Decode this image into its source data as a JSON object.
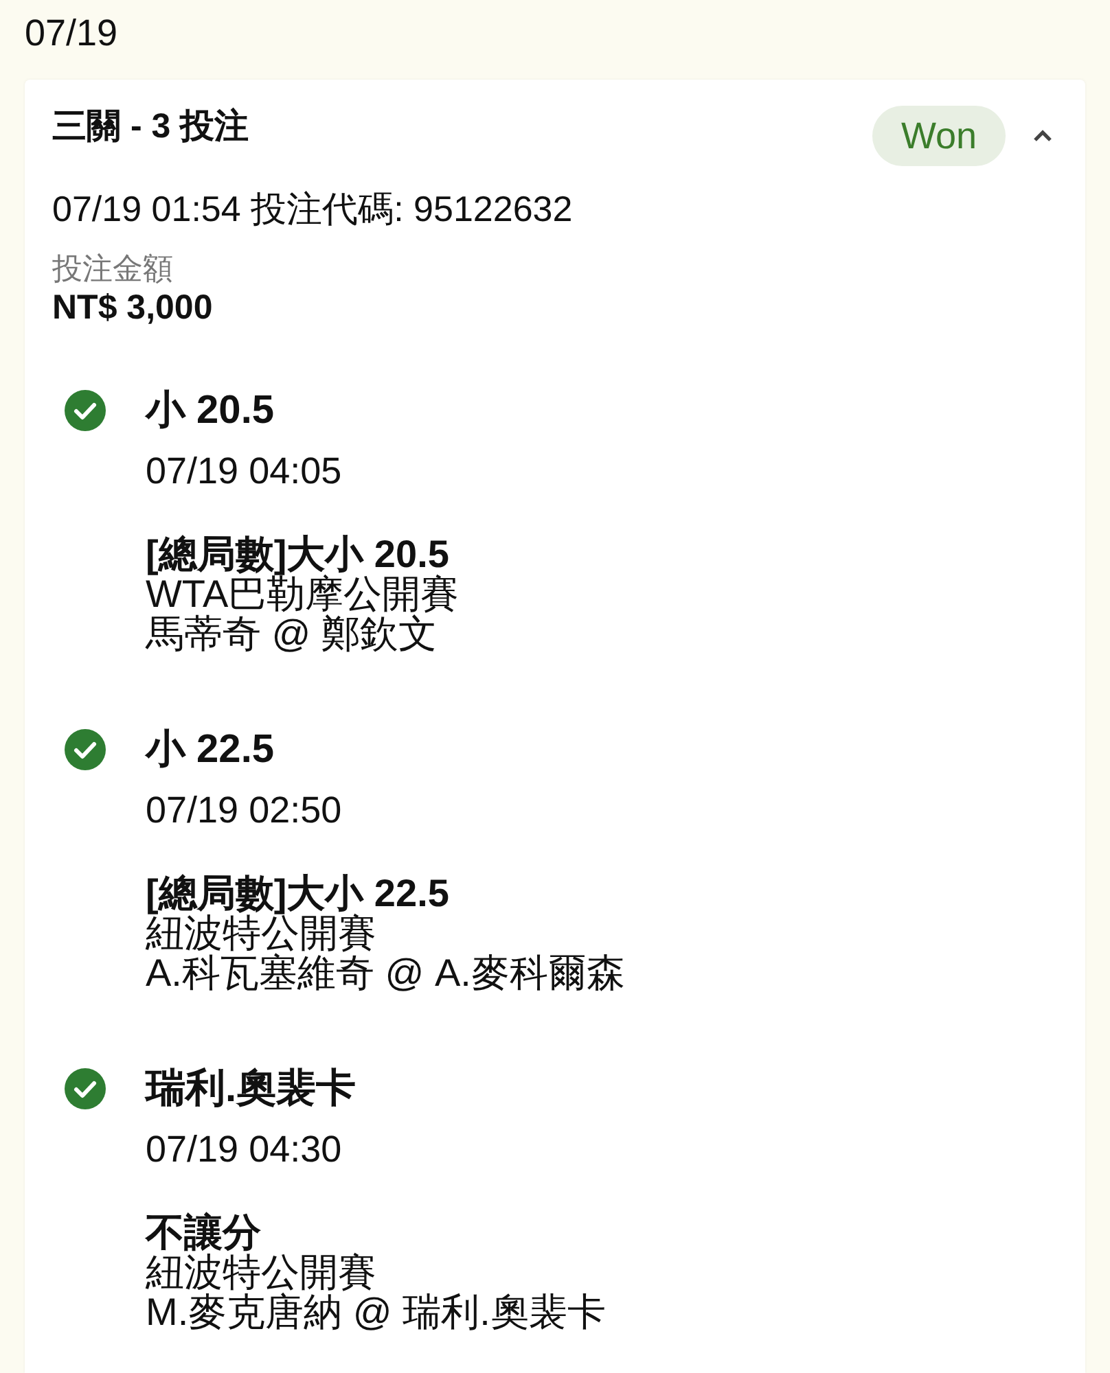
{
  "date_header": "07/19",
  "bet": {
    "title": "三關 - 3 投注",
    "status": "Won",
    "expanded": true,
    "placed": "07/19 01:54 投注代碼: 95122632",
    "stake_label": "投注金額",
    "stake": "NT$ 3,000",
    "legs": [
      {
        "won": true,
        "selection": "小 20.5",
        "time": "07/19 04:05",
        "market": "[總局數]大小 20.5",
        "event": "WTA巴勒摩公開賽",
        "match": "馬蒂奇 @ 鄭欽文"
      },
      {
        "won": true,
        "selection": "小 22.5",
        "time": "07/19 02:50",
        "market": "[總局數]大小 22.5",
        "event": "紐波特公開賽",
        "match": "A.科瓦塞維奇 @ A.麥科爾森"
      },
      {
        "won": true,
        "selection": "瑞利.奧裴卡",
        "time": "07/19 04:30",
        "market": "不讓分",
        "event": "紐波特公開賽",
        "match": "M.麥克唐納 @ 瑞利.奧裴卡"
      }
    ]
  }
}
